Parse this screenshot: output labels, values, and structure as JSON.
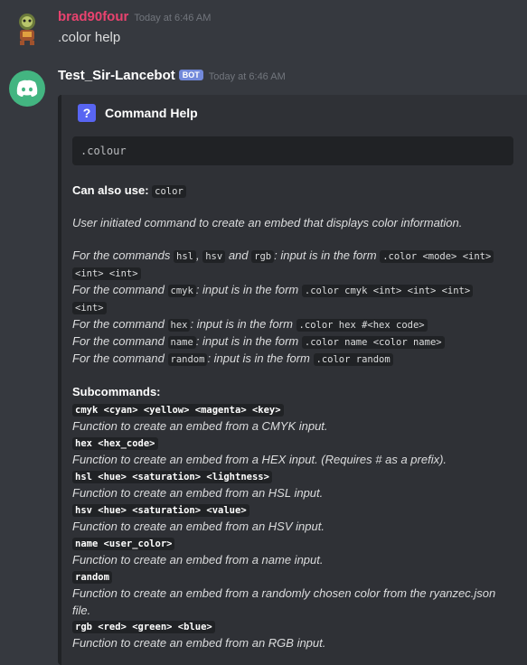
{
  "msg1": {
    "author": "brad90four",
    "timestamp": "Today at 6:46 AM",
    "text": ".color help",
    "author_color": "#e9436f"
  },
  "msg2": {
    "author": "Test_Sir-Lancebot",
    "bot_tag": "BOT",
    "timestamp": "Today at 6:46 AM"
  },
  "embed": {
    "title": "Command Help",
    "title_icon": "?",
    "code": ".colour",
    "also_label": "Can also use:",
    "also_value": "color",
    "description": "User initiated command to create an embed that displays color information.",
    "for1_a": "For the commands",
    "for1_hsl": "hsl",
    "for1_sep1": ",",
    "for1_hsv": "hsv",
    "for1_and": "and",
    "for1_rgb": "rgb",
    "for1_b": ": input is in the form",
    "for1_code1": ".color <mode> <int>",
    "for1_code2": "<int> <int>",
    "cmyk_a": "For the command",
    "cmyk_cmd": "cmyk",
    "cmyk_b": ": input is in the form",
    "cmyk_code1": ".color cmyk <int> <int> <int>",
    "cmyk_code2": "<int>",
    "hex_a": "For the command",
    "hex_cmd": "hex",
    "hex_b": ": input is in the form",
    "hex_code": ".color hex #<hex code>",
    "name_a": "For the command",
    "name_cmd": "name",
    "name_b": ": input is in the form",
    "name_code": ".color name <color name>",
    "random_a": "For the command",
    "random_cmd": "random",
    "random_b": ": input is in the form",
    "random_code": ".color random",
    "subcommands_label": "Subcommands:",
    "subcommands": [
      {
        "sig": "cmyk <cyan> <yellow> <magenta> <key>",
        "desc": "Function to create an embed from a CMYK input."
      },
      {
        "sig": "hex <hex_code>",
        "desc": "Function to create an embed from a HEX input. (Requires # as a prefix)."
      },
      {
        "sig": "hsl <hue> <saturation> <lightness>",
        "desc": "Function to create an embed from an HSL input."
      },
      {
        "sig": "hsv <hue> <saturation> <value>",
        "desc": "Function to create an embed from an HSV input."
      },
      {
        "sig": "name <user_color>",
        "desc": "Function to create an embed from a name input."
      },
      {
        "sig": "random",
        "desc": "Function to create an embed from a randomly chosen color from the ryanzec.json"
      },
      {
        "sig": "rgb <red> <green> <blue>",
        "desc": "Function to create an embed from an RGB input."
      }
    ],
    "random_desc_cont": "file."
  }
}
